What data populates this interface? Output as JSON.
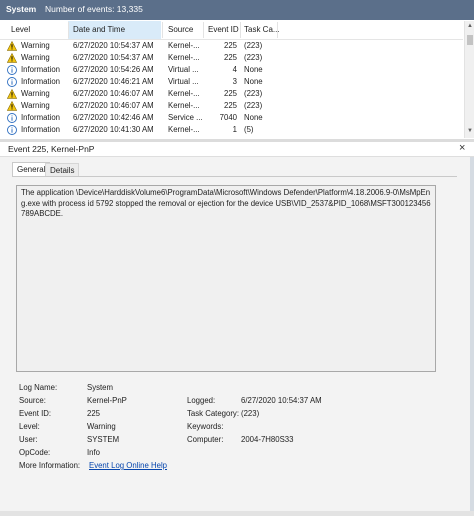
{
  "header": {
    "title": "System",
    "count": "Number of events: 13,335"
  },
  "columns": {
    "level": "Level",
    "date": "Date and Time",
    "source": "Source",
    "event_id": "Event ID",
    "task": "Task Ca..."
  },
  "rows": [
    {
      "level": "Warning",
      "icon": "warning-icon",
      "date": "6/27/2020 10:54:37 AM",
      "source": "Kernel-...",
      "id": "225",
      "task": "(223)"
    },
    {
      "level": "Warning",
      "icon": "warning-icon",
      "date": "6/27/2020 10:54:37 AM",
      "source": "Kernel-...",
      "id": "225",
      "task": "(223)"
    },
    {
      "level": "Information",
      "icon": "info-icon",
      "date": "6/27/2020 10:54:26 AM",
      "source": "Virtual ...",
      "id": "4",
      "task": "None"
    },
    {
      "level": "Information",
      "icon": "info-icon",
      "date": "6/27/2020 10:46:21 AM",
      "source": "Virtual ...",
      "id": "3",
      "task": "None"
    },
    {
      "level": "Warning",
      "icon": "warning-icon",
      "date": "6/27/2020 10:46:07 AM",
      "source": "Kernel-...",
      "id": "225",
      "task": "(223)"
    },
    {
      "level": "Warning",
      "icon": "warning-icon",
      "date": "6/27/2020 10:46:07 AM",
      "source": "Kernel-...",
      "id": "225",
      "task": "(223)"
    },
    {
      "level": "Information",
      "icon": "info-icon",
      "date": "6/27/2020 10:42:46 AM",
      "source": "Service ...",
      "id": "7040",
      "task": "None"
    },
    {
      "level": "Information",
      "icon": "info-icon",
      "date": "6/27/2020 10:41:30 AM",
      "source": "Kernel-...",
      "id": "1",
      "task": "(5)"
    }
  ],
  "details": {
    "title": "Event 225, Kernel-PnP",
    "tabs": {
      "general": "General",
      "details": "Details"
    },
    "message": "The application \\Device\\HarddiskVolume6\\ProgramData\\Microsoft\\Windows Defender\\Platform\\4.18.2006.9-0\\MsMpEng.exe with process id 5792 stopped the removal or ejection for the device USB\\VID_2537&PID_1068\\MSFT300123456789ABCDE.",
    "props": {
      "log_name_label": "Log Name:",
      "log_name": "System",
      "source_label": "Source:",
      "source": "Kernel-PnP",
      "logged_label": "Logged:",
      "logged": "6/27/2020 10:54:37 AM",
      "event_id_label": "Event ID:",
      "event_id": "225",
      "task_category_label": "Task Category:",
      "task_category": "(223)",
      "level_label": "Level:",
      "level": "Warning",
      "keywords_label": "Keywords:",
      "keywords": "",
      "user_label": "User:",
      "user": "SYSTEM",
      "computer_label": "Computer:",
      "computer": "2004-7H80S33",
      "opcode_label": "OpCode:",
      "opcode": "Info",
      "more_info_label": "More Information:",
      "more_info_link": "Event Log Online Help"
    }
  },
  "colors": {
    "header_bar": "#5b6f8a",
    "warning": "#f2c511",
    "info": "#2f6fc1",
    "link": "#0645ad"
  }
}
